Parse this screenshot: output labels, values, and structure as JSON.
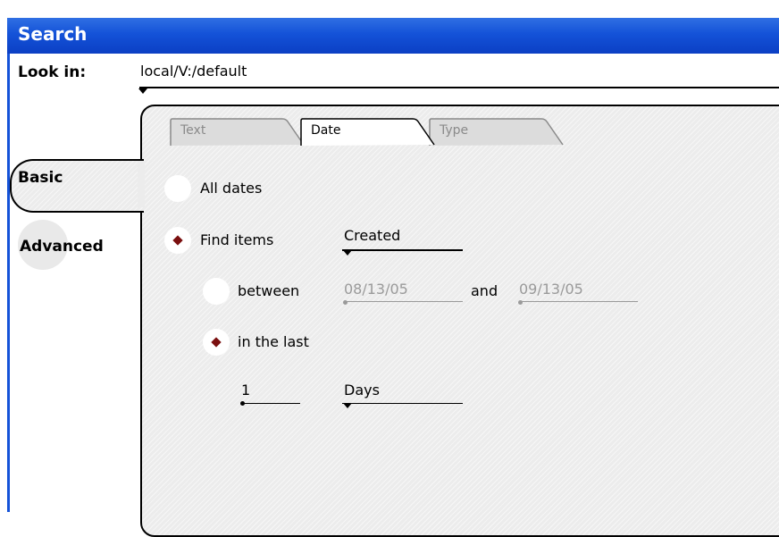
{
  "window": {
    "title": "Search"
  },
  "look_in": {
    "label": "Look in:",
    "value": "local/V:/default"
  },
  "side_tabs": [
    {
      "label": "Basic",
      "selected": true
    },
    {
      "label": "Advanced",
      "selected": false
    }
  ],
  "tabs": [
    {
      "label": "Text",
      "selected": false
    },
    {
      "label": "Date",
      "selected": true
    },
    {
      "label": "Type",
      "selected": false
    }
  ],
  "date_options": {
    "all_dates_label": "All dates",
    "find_items_label": "Find items",
    "find_items_select": "Created",
    "between_label": "between",
    "start_date": "08/13/05",
    "and_label": "and",
    "end_date": "09/13/05",
    "in_the_last_label": "in the last",
    "last_count": "1",
    "last_unit": "Days"
  },
  "colors": {
    "title_bar": "#1452d8",
    "radio_dot": "#7a0f0f",
    "disabled_text": "#9a9a9a"
  }
}
